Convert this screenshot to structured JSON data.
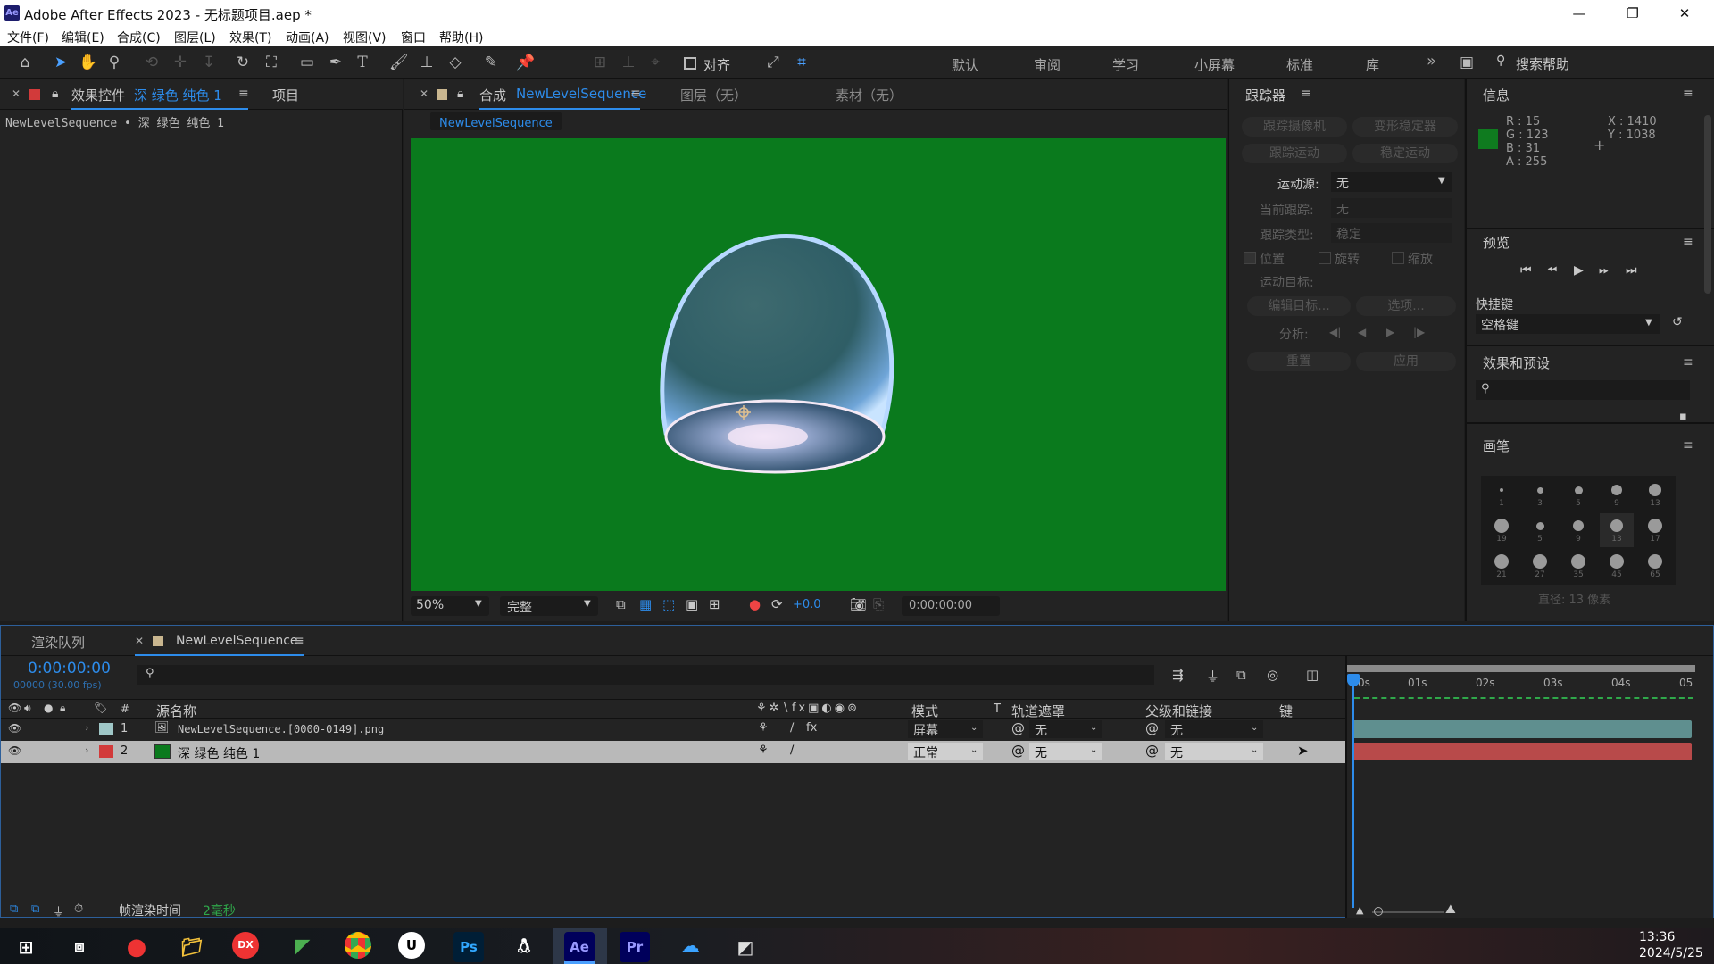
{
  "window": {
    "app_icon": "Ae",
    "title": "Adobe After Effects 2023 - 无标题项目.aep *",
    "controls": [
      "—",
      "❐",
      "✕"
    ]
  },
  "menu": [
    "文件(F)",
    "编辑(E)",
    "合成(C)",
    "图层(L)",
    "效果(T)",
    "动画(A)",
    "视图(V)",
    "窗口",
    "帮助(H)"
  ],
  "toolbar": {
    "align_label": "对齐",
    "workspaces": [
      "默认",
      "审阅",
      "学习",
      "小屏幕",
      "标准",
      "库"
    ],
    "more": "»",
    "search_placeholder": "搜索帮助"
  },
  "effect_controls": {
    "tab_prefix": "效果控件",
    "tab_layer": "深 绿色 纯色 1",
    "project_tab": "项目",
    "breadcrumb": "NewLevelSequence • 深 绿色 纯色 1"
  },
  "composition": {
    "tab_prefix": "合成",
    "tab_name": "NewLevelSequence",
    "layer_tab": "图层（无）",
    "footage_tab": "素材（无）",
    "breadcrumb": "NewLevelSequence",
    "bg_color": "#0a7a1d",
    "zoom": "50%",
    "resolution": "完整",
    "exposure": "+0.0",
    "timecode": "0:00:00:00"
  },
  "tracker": {
    "title": "跟踪器",
    "btn_track_camera": "跟踪摄像机",
    "btn_warp_stabilizer": "变形稳定器",
    "btn_track_motion": "跟踪运动",
    "btn_stabilize_motion": "稳定运动",
    "motion_source_label": "运动源:",
    "motion_source_value": "无",
    "current_track_label": "当前跟踪:",
    "current_track_value": "无",
    "track_type_label": "跟踪类型:",
    "track_type_value": "稳定",
    "cb_position": "位置",
    "cb_rotation": "旋转",
    "cb_scale": "缩放",
    "motion_target": "运动目标:",
    "btn_edit_target": "编辑目标...",
    "btn_options": "选项...",
    "analyze_label": "分析:",
    "btn_reset": "重置",
    "btn_apply": "应用"
  },
  "info": {
    "title": "信息",
    "swatch": "#0f7b1f",
    "r": "R : 15",
    "g": "G : 123",
    "b": "B : 31",
    "a": "A : 255",
    "x": "X : 1410",
    "y": "Y : 1038"
  },
  "preview": {
    "title": "预览",
    "shortcut_label": "快捷键",
    "shortcut_value": "空格键"
  },
  "effects_presets": {
    "title": "效果和预设"
  },
  "brush": {
    "title": "画笔",
    "sizes": [
      "1",
      "3",
      "5",
      "9",
      "13",
      "19",
      "5",
      "9",
      "13",
      "17",
      "21",
      "27",
      "35",
      "45",
      "65"
    ],
    "diameter": "直径: 13 像素"
  },
  "timeline": {
    "render_queue_tab": "渲染队列",
    "comp_tab": "NewLevelSequence",
    "timecode": "0:00:00:00",
    "frame_info": "00000 (30.00 fps)",
    "col_num": "#",
    "col_source": "源名称",
    "col_mode": "模式",
    "col_t": "T",
    "col_trackmatte": "轨道遮罩",
    "col_parent": "父级和链接",
    "col_keys": "键",
    "ruler": [
      "0s",
      "01s",
      "02s",
      "03s",
      "04s",
      "05"
    ],
    "layers": [
      {
        "num": "1",
        "name": "NewLevelSequence.[0000-0149].png",
        "mode": "屏幕",
        "matte": "无",
        "parent": "无",
        "label": "#9fc7c7",
        "bar": "#5f8f8f"
      },
      {
        "num": "2",
        "name": "深 绿色 纯色 1",
        "mode": "正常",
        "matte": "无",
        "parent": "无",
        "label": "#d23a3a",
        "bar": "#b84a4a"
      }
    ],
    "footer_label": "帧渲染时间",
    "footer_value": "2毫秒"
  },
  "taskbar": {
    "time": "13:36",
    "date": "2024/5/25",
    "apps": [
      "start",
      "task-view",
      "record",
      "explorer",
      "dx",
      "green-app",
      "chrome",
      "unreal",
      "Ps",
      "qq",
      "Ae",
      "Pr",
      "baidu-netdisk",
      "tool"
    ]
  }
}
